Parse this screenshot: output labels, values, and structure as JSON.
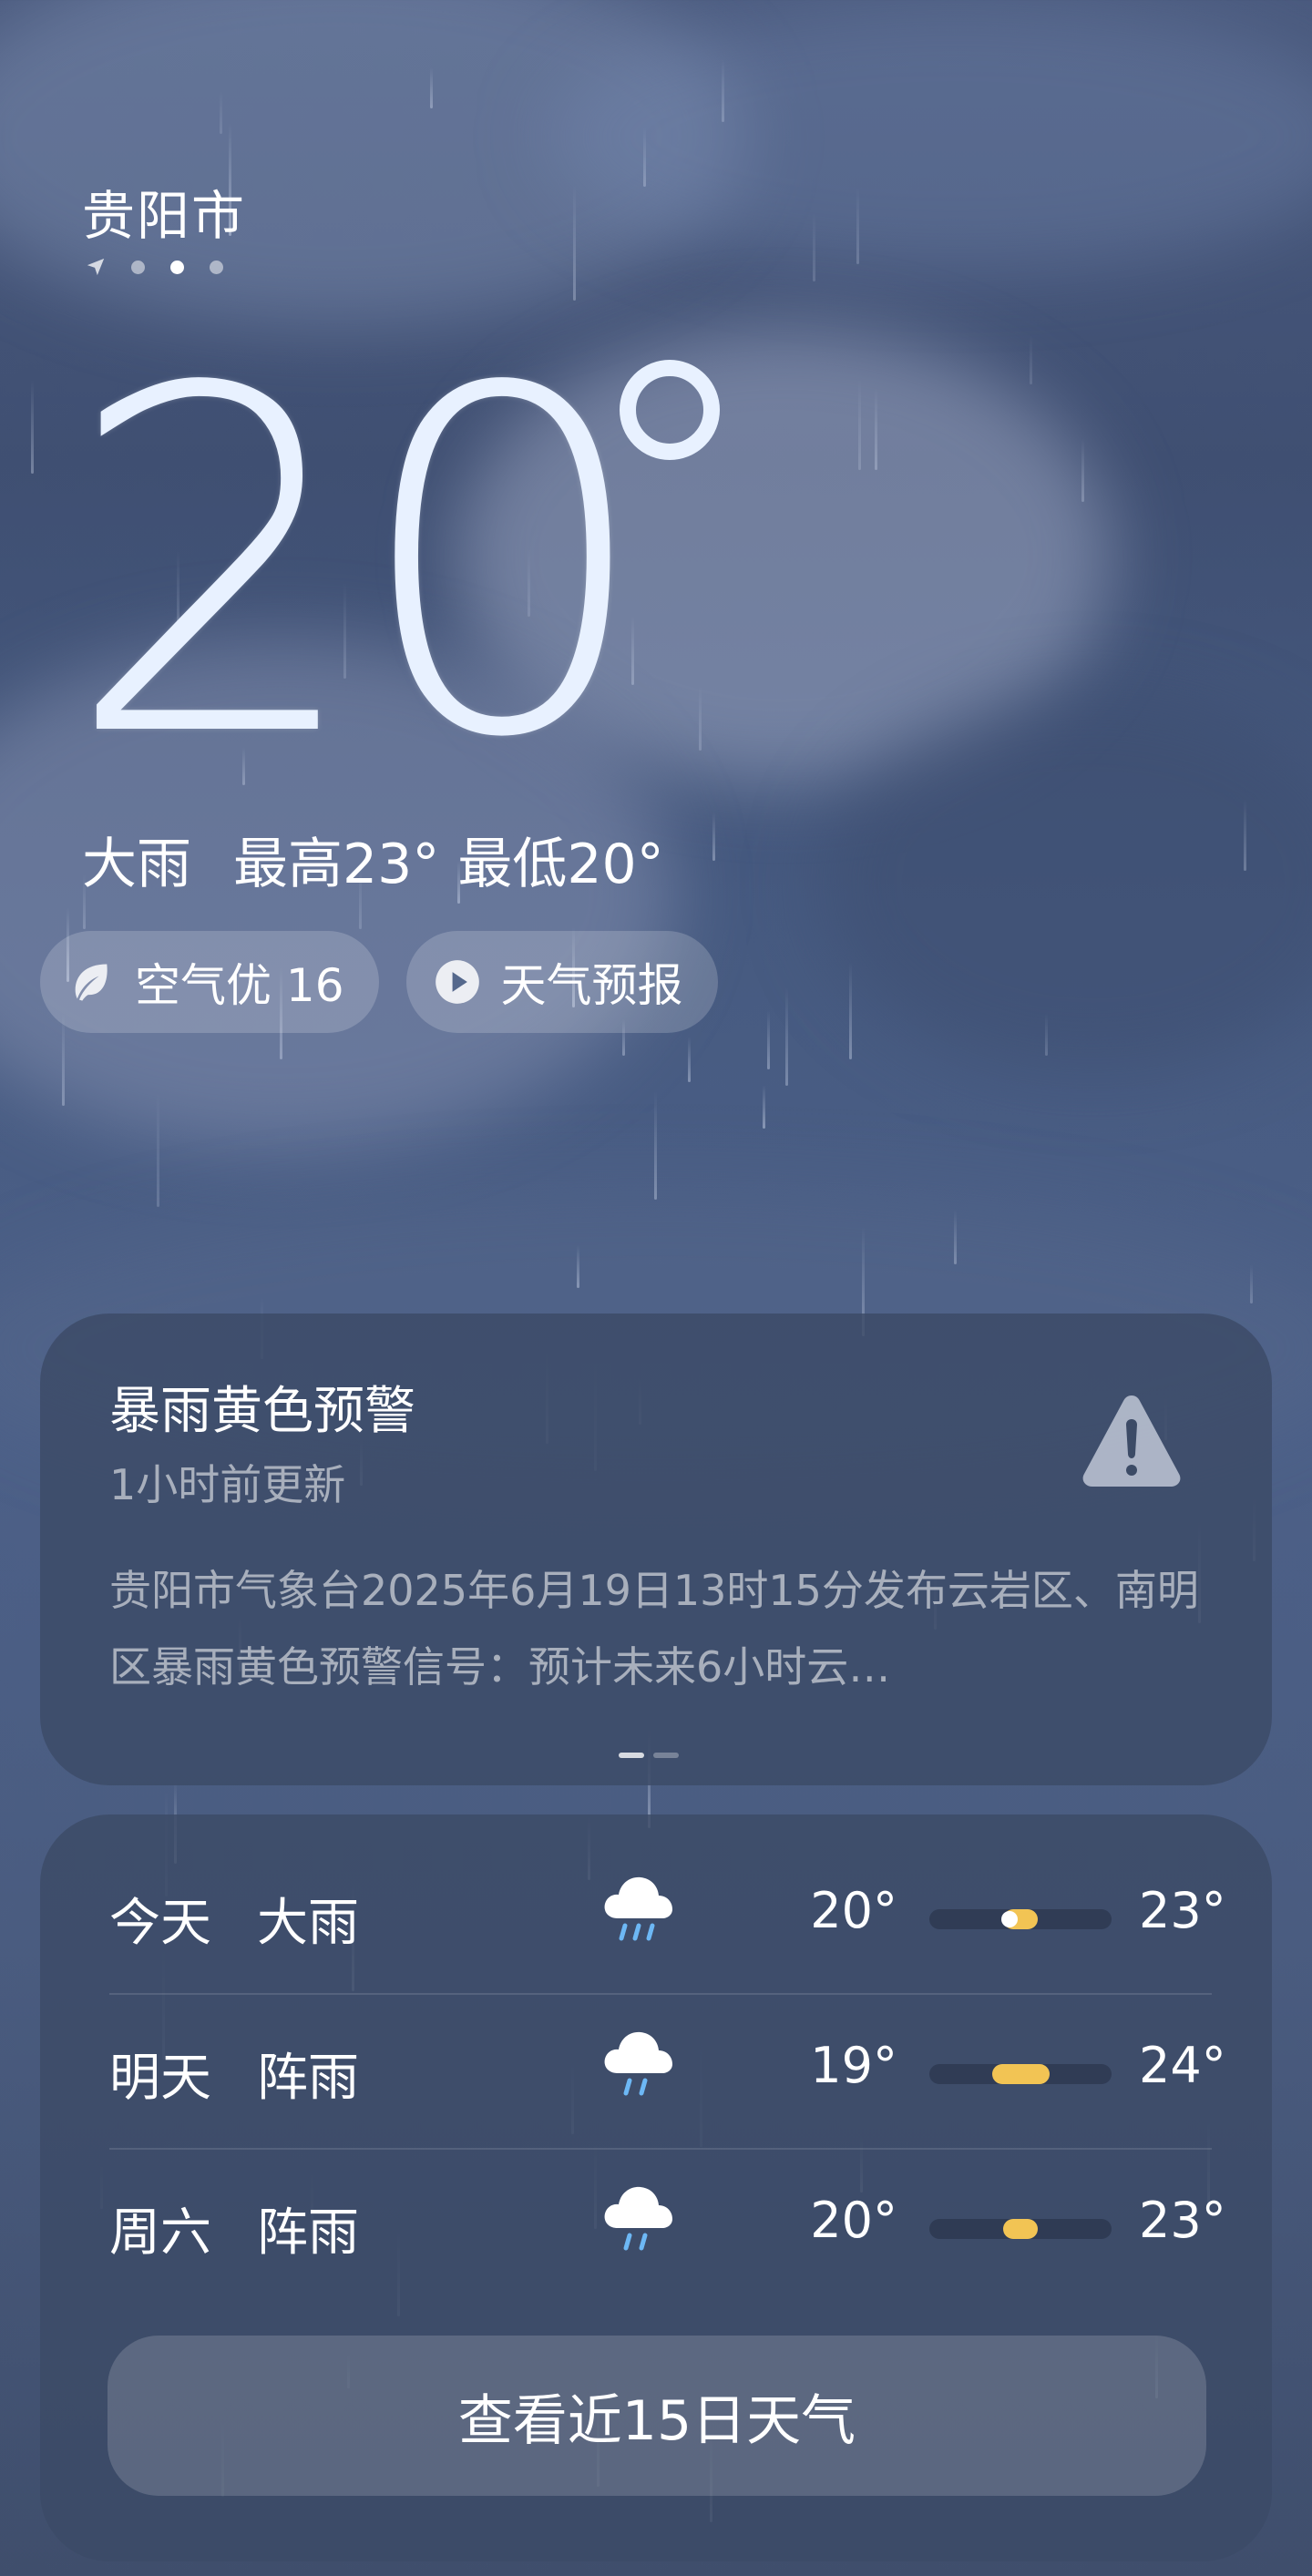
{
  "header": {
    "city": "贵阳市",
    "page_dots": [
      {
        "type": "location",
        "active": false
      },
      {
        "type": "dot",
        "active": false
      },
      {
        "type": "dot",
        "active": true
      },
      {
        "type": "dot",
        "active": false
      }
    ]
  },
  "current": {
    "temperature": "20",
    "condition": "大雨",
    "high": "最高23°",
    "low": "最低20°"
  },
  "chips": {
    "aqi_label": "空气优 16",
    "forecast_label": "天气预报"
  },
  "alert": {
    "title": "暴雨黄色预警",
    "updated": "1小时前更新",
    "body": "贵阳市气象台2025年6月19日13时15分发布云岩区、南明区暴雨黄色预警信号：预计未来6小时云…",
    "icon": "warning-triangle-icon"
  },
  "forecast": {
    "days": [
      {
        "day": "今天",
        "condition": "大雨",
        "icon": "heavy-rain-icon",
        "low": "20°",
        "high": "23°",
        "low_value": 20,
        "high_value": 23,
        "current_value": 20
      },
      {
        "day": "明天",
        "condition": "阵雨",
        "icon": "shower-icon",
        "low": "19°",
        "high": "24°",
        "low_value": 19,
        "high_value": 24
      },
      {
        "day": "周六",
        "condition": "阵雨",
        "icon": "shower-icon",
        "low": "20°",
        "high": "23°",
        "low_value": 20,
        "high_value": 23
      }
    ],
    "range_min": 19,
    "range_max": 24,
    "button_label": "查看近15日天气"
  },
  "colors": {
    "background": "#465a80",
    "card": "#3c4b66",
    "temp_bar_fill": "#f2c454",
    "text": "#ffffff"
  }
}
